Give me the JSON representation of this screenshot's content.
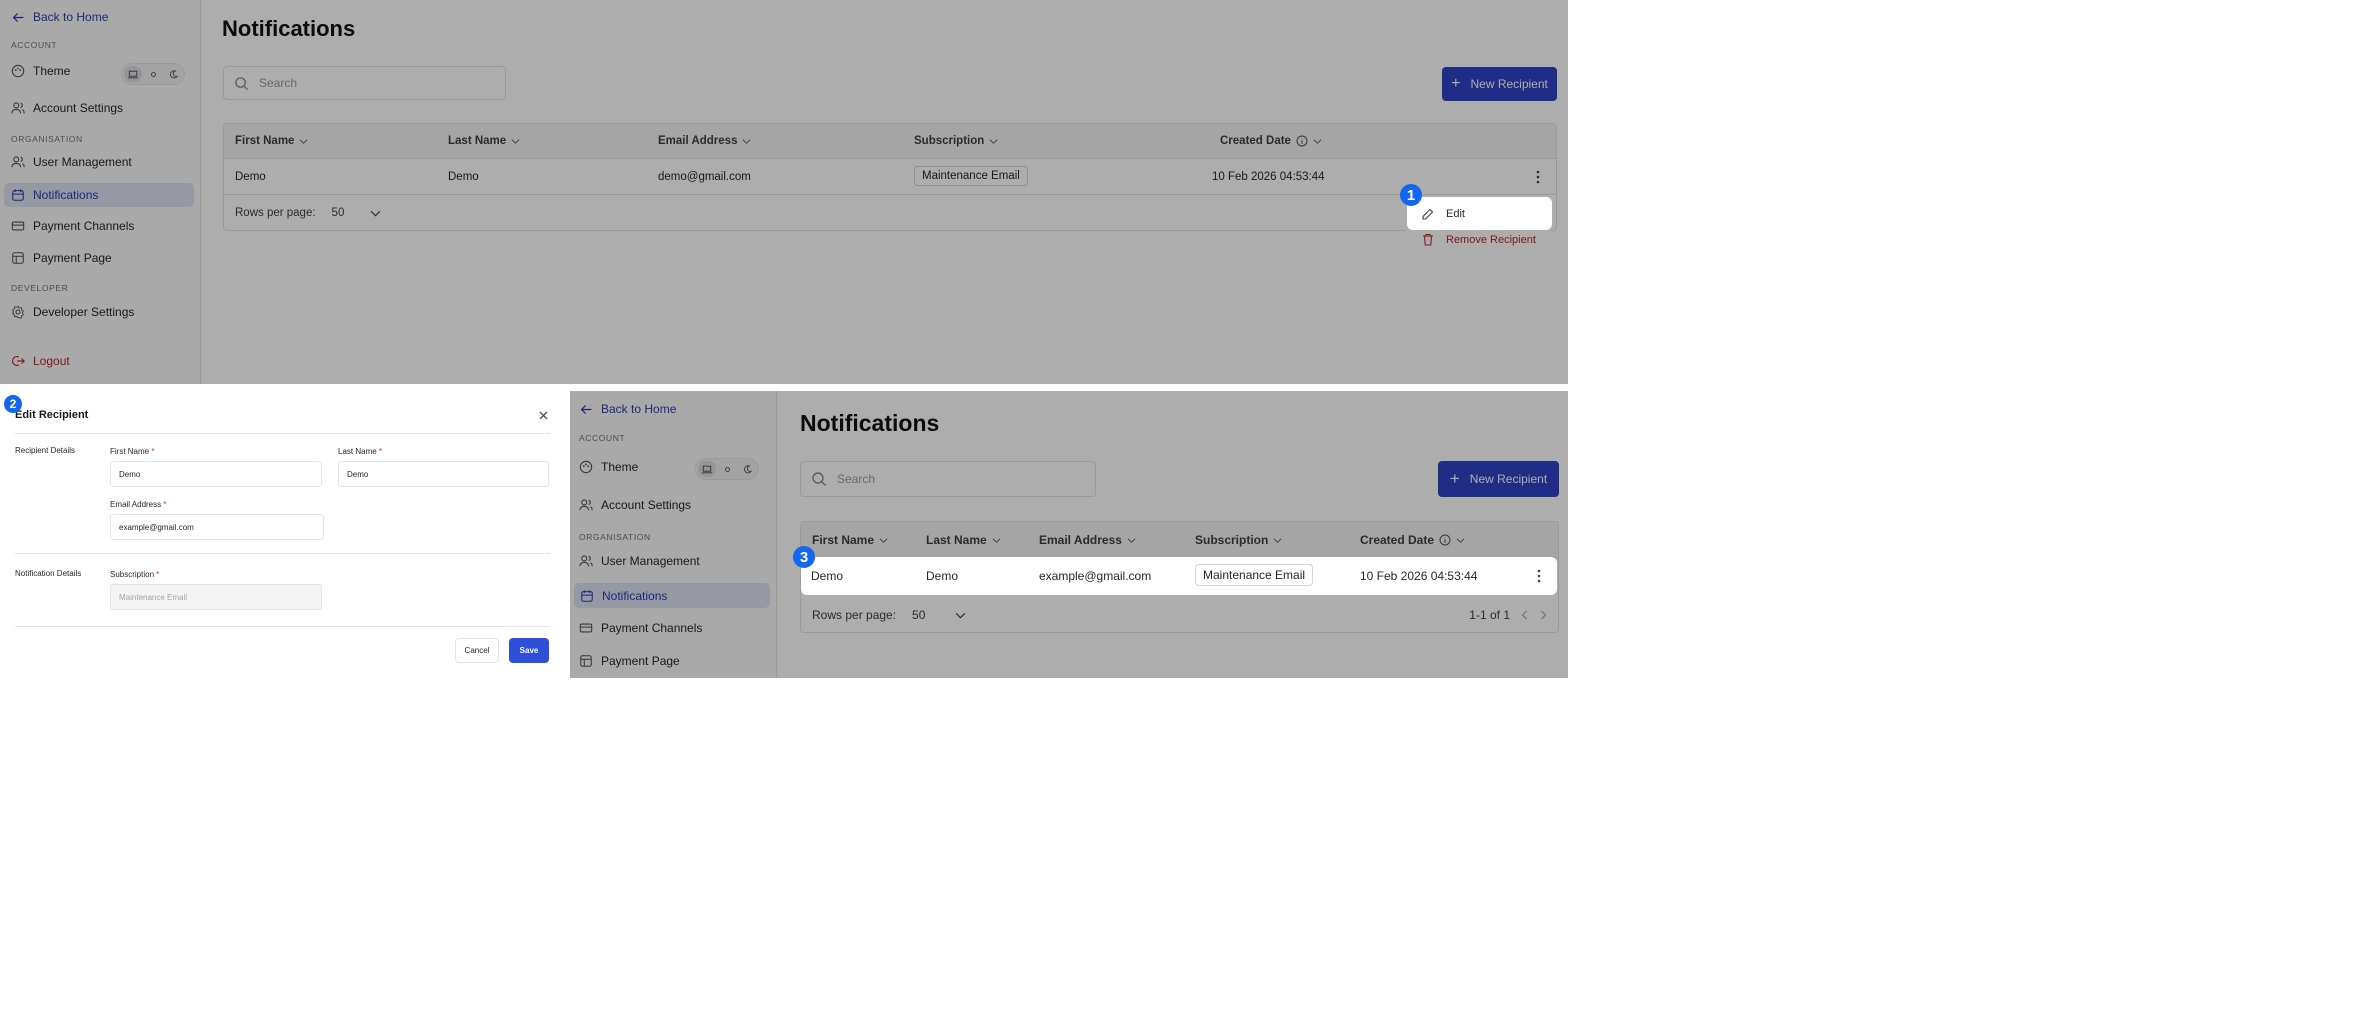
{
  "sidebar": {
    "back_label": "Back to Home",
    "section_account": "ACCOUNT",
    "theme_label": "Theme",
    "account_settings": "Account Settings",
    "section_org": "ORGANISATION",
    "user_management": "User Management",
    "notifications": "Notifications",
    "payment_channels": "Payment Channels",
    "payment_page": "Payment Page",
    "section_dev": "DEVELOPER",
    "developer_settings": "Developer Settings",
    "logout": "Logout"
  },
  "page": {
    "title": "Notifications",
    "search_placeholder": "Search",
    "new_button": "New Recipient"
  },
  "table": {
    "headers": [
      "First Name",
      "Last Name",
      "Email Address",
      "Subscription",
      "Created Date"
    ],
    "row_top": {
      "first": "Demo",
      "last": "Demo",
      "email": "demo@gmail.com",
      "subscription": "Maintenance Email",
      "created": "10 Feb 2026 04:53:44"
    },
    "row_bottom": {
      "first": "Demo",
      "last": "Demo",
      "email": "example@gmail.com",
      "subscription": "Maintenance Email",
      "created": "10 Feb 2026 04:53:44"
    },
    "rows_per_page_label": "Rows per page:",
    "rows_per_page_value": "50",
    "pagination_text": "1-1 of 1"
  },
  "row_menu": {
    "edit": "Edit",
    "remove": "Remove Recipient"
  },
  "modal": {
    "title": "Edit Recipient",
    "recipient_details": "Recipient Details",
    "first_name_label": "First Name",
    "first_name_value": "Demo",
    "last_name_label": "Last Name",
    "last_name_value": "Demo",
    "email_label": "Email Address",
    "email_value": "example@gmail.com",
    "notification_details": "Notification Details",
    "subscription_label": "Subscription",
    "subscription_value": "Maintenance Email",
    "required_mark": "*",
    "cancel": "Cancel",
    "save": "Save"
  },
  "markers": [
    "1",
    "2",
    "3"
  ],
  "colors": {
    "accent": "#2f43c6",
    "active_nav": "#dde2f0",
    "danger": "#c0262d",
    "marker": "#1366f0"
  }
}
